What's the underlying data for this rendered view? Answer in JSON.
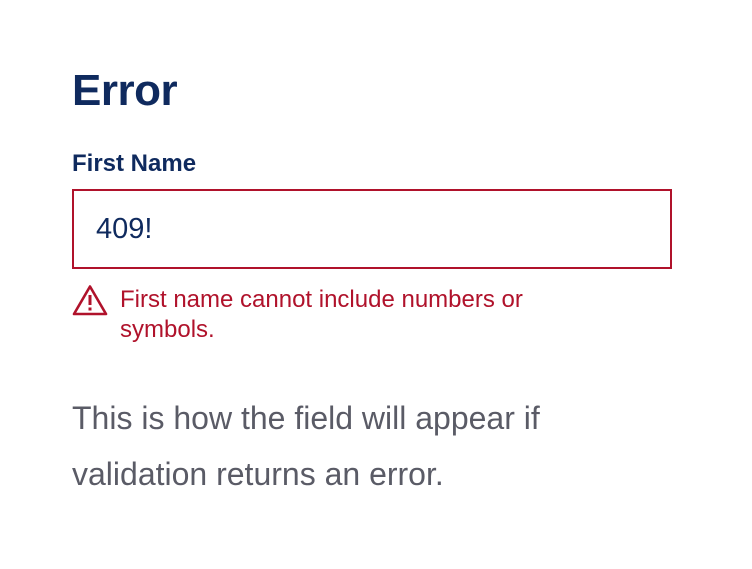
{
  "heading": "Error",
  "field": {
    "label": "First Name",
    "value": "409!",
    "error_message": "First name cannot include numbers or symbols."
  },
  "help_text": "This is how the field will appear if validation returns an error.",
  "icons": {
    "error": "warning-triangle-icon"
  },
  "colors": {
    "heading": "#0f2a5e",
    "error": "#b0122b",
    "body_text": "#5a5b66"
  }
}
